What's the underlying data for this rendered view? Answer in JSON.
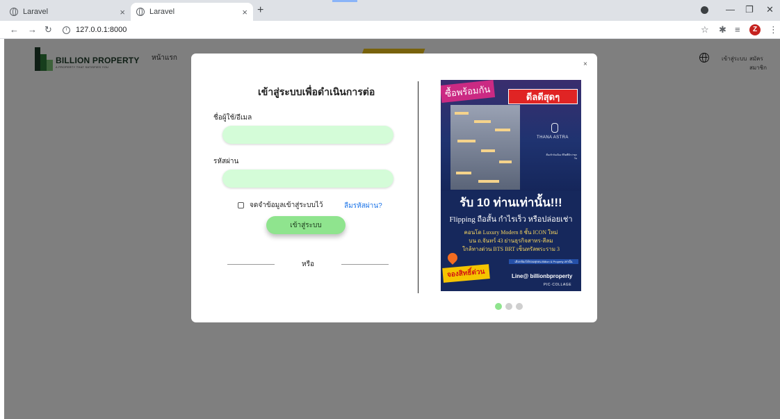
{
  "browser": {
    "tabs": [
      {
        "title": "Laravel",
        "active": false
      },
      {
        "title": "Laravel",
        "active": true
      }
    ],
    "url": "127.0.0.1:8000",
    "profile_initial": "Z"
  },
  "site": {
    "brand": "BILLION PROPERTY",
    "tagline": "A PROPERTY THAT SATISFIES YOU",
    "nav_home": "หน้าแรก",
    "nav_login": "เข้าสู่ระบบ",
    "nav_register": "สมัครสมาชิก"
  },
  "modal": {
    "close": "×",
    "title": "เข้าสู่ระบบเพื่อดำเนินการต่อ",
    "username_label": "ชื่อผู้ใช้/อีเมล",
    "username_value": "",
    "password_label": "รหัสผ่าน",
    "password_value": "",
    "remember_label": "จดจำข้อมูลเข้าสู่ระบบไว้",
    "remember_checked": false,
    "forgot_label": "ลืมรหัสผ่าน?",
    "login_button": "เข้าสู่ระบบ",
    "or_text": "หรือ"
  },
  "ad": {
    "tag_left": "ซื้อพร้อมกัน",
    "tag_right": "ดีลดีสุดๆ",
    "brand": "THANA ASTRA",
    "small_text": "ตื่นเช้ากับเมือง ชีวิตที่ดีกว่าทุกวัน",
    "headline": "รับ 10 ท่านเท่านั้น!!!",
    "subline": "Flipping ถือสั้น กำไรเร็ว หรือปล่อยเช่า",
    "line1": "คอนโด Luxury Modern 8 ชั้น ICON ใหม่",
    "line2": "บน ถ.จันทร์ 43 ย่านธุรกิจสาทร-สีลม",
    "line3": "ใกล้ทางด่วน BTS BRT เซ็นทรัลพระราม 3",
    "strip": "เลือกห้องได้ก่อนทุกคน Billion & Property เท่านั้น",
    "reserve": "จองสิทธิ์ด่วน",
    "line_id": "Line@ billionbproperty",
    "watermark": "PIC·COLLAGE"
  },
  "carousel": {
    "count": 3,
    "active_index": 0
  },
  "colors": {
    "input_bg": "#d4fcd8",
    "button_bg": "#8fe48e",
    "overlay": "rgba(0,0,0,0.5)",
    "link": "#1a73e8",
    "ad_navy": "#16285c"
  }
}
